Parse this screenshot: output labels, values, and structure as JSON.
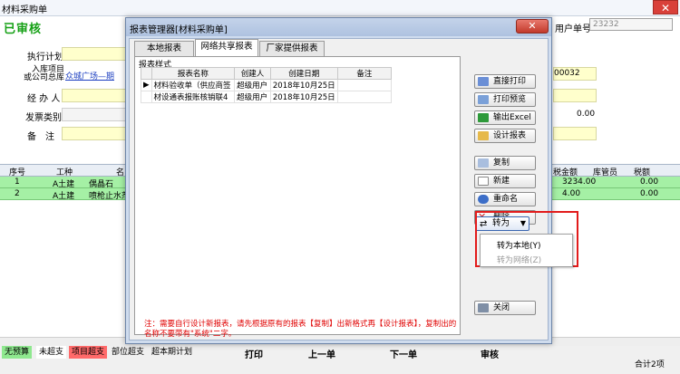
{
  "background": {
    "window_title": "材料采购单",
    "status_stamp": "已审核",
    "doc_no_label": "用户单号",
    "doc_no_value": "23232",
    "form": {
      "plan_label": "执行计划",
      "project_label": "入库项目\n或公司总库",
      "project_value": "众城广场—期",
      "handler_label": "经 办 人",
      "invoice_label": "发票类别",
      "remark_label": "备　注",
      "code_tail": "00032",
      "amount_value": "0.00"
    },
    "grid": {
      "columns": [
        "序号",
        "工种",
        "名",
        "税金额",
        "库管员",
        "税额"
      ],
      "rows": [
        {
          "no": "1",
          "trade": "A土建",
          "name": "偶晶石",
          "tax_amount": "3234.00",
          "tax": "0.00"
        },
        {
          "no": "2",
          "trade": "A土建",
          "name": "喷枪止水剂",
          "tax_amount": "4.00",
          "tax": "0.00"
        }
      ]
    },
    "legend": [
      "无预算",
      "未超支",
      "项目超支",
      "部位超支",
      "超本期计划"
    ],
    "bottom_buttons": [
      "打印",
      "上一单",
      "下一单",
      "审核"
    ],
    "total_label": "合计2项"
  },
  "dialog": {
    "title": "报表管理器[材料采购单]",
    "close_label": "✕",
    "tabs": [
      "本地报表",
      "网络共享报表",
      "厂家提供报表"
    ],
    "active_tab": 1,
    "group_title": "报表样式",
    "table": {
      "headers": [
        "报表名称",
        "创建人",
        "创建日期",
        "备注"
      ],
      "rows": [
        {
          "name": "材料验收单（供应商签",
          "creator": "超级用户",
          "date": "2018年10月25日",
          "note": ""
        },
        {
          "name": "材设通表报账核销联4",
          "creator": "超级用户",
          "date": "2018年10月25日",
          "note": ""
        }
      ]
    },
    "note": "注：需要自行设计新报表，请先根据原有的报表【复制】出新格式再【设计报表】，复制出的名称不要带有\"系统\"二字。",
    "buttons": {
      "print": "直接打印",
      "preview": "打印预览",
      "excel": "输出Excel",
      "design": "设计报表",
      "copy": "复制",
      "new": "新建",
      "rename": "重命名",
      "delete": "删除",
      "convert": "转为",
      "close": "关闭"
    },
    "convert_menu": [
      {
        "label": "转为本地(Y)",
        "enabled": true
      },
      {
        "label": "转为网络(Z)",
        "enabled": false
      }
    ]
  }
}
